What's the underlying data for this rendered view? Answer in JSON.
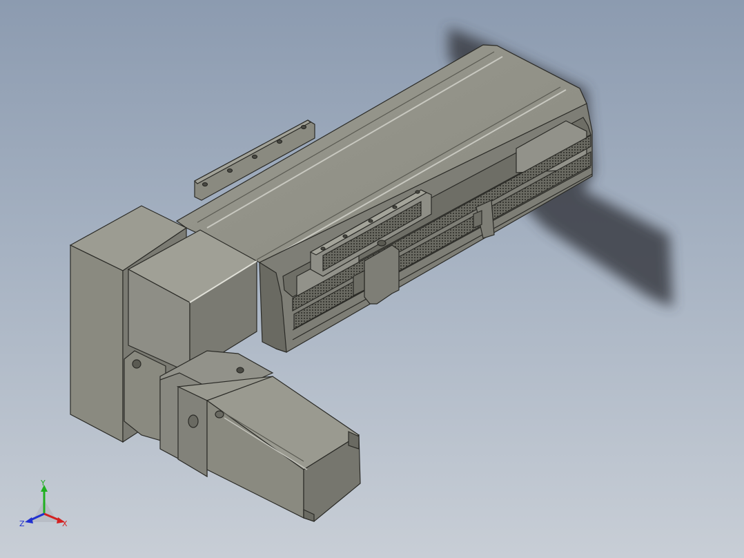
{
  "viewport": {
    "background_top": "#8c9bb0",
    "background_bottom": "#c8ced6"
  },
  "model": {
    "body_color": "#8a8a80",
    "dark_edge": "#2a2a26",
    "shadow_color": "#3a3e44"
  },
  "triad": {
    "x_label": "X",
    "y_label": "Y",
    "z_label": "Z",
    "x_color": "#d42020",
    "y_color": "#20b020",
    "z_color": "#2030d0"
  }
}
